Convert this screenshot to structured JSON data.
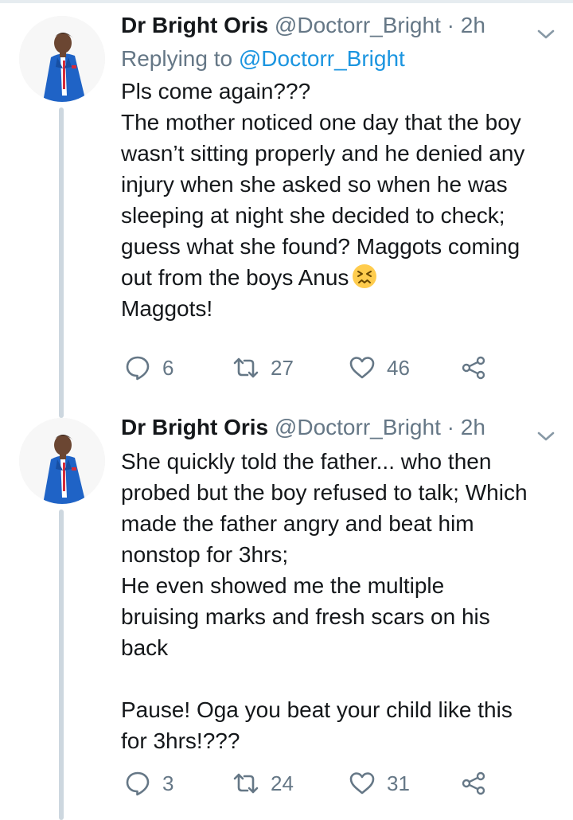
{
  "tweets": [
    {
      "display_name": "Dr Bright Oris",
      "handle": "@Doctorr_Bright",
      "separator": "·",
      "time": "2h",
      "replying_prefix": "Replying to",
      "replying_to": "@Doctorr_Bright",
      "lines": [
        "Pls come again???",
        "The mother noticed one day that the boy",
        "wasn’t sitting properly and he denied any",
        "injury when she asked so when he was",
        "sleeping at night she decided to check;",
        "guess what she found? Maggots coming",
        "out from the boys Anus",
        "Maggots!"
      ],
      "emoji": "confounded-face-emoji",
      "replies": "6",
      "retweets": "27",
      "likes": "46"
    },
    {
      "display_name": "Dr Bright Oris",
      "handle": "@Doctorr_Bright",
      "separator": "·",
      "time": "2h",
      "lines": [
        "She quickly told the father... who then",
        "probed but the boy refused to talk; Which",
        "made the father angry and beat him",
        "nonstop for 3hrs;",
        "He even showed me the multiple",
        "bruising marks and fresh scars on his",
        "back",
        "",
        "Pause! Oga you beat your child like this",
        "for 3hrs!???"
      ],
      "replies": "3",
      "retweets": "24",
      "likes": "31"
    }
  ],
  "colors": {
    "text": "#14171a",
    "secondary": "#657786",
    "link": "#1b95e0",
    "thread_line": "#cdd7df",
    "avatar_suit": "#1f63c6"
  },
  "icons": {
    "reply": "reply-icon",
    "retweet": "retweet-icon",
    "like": "heart-icon",
    "share": "share-icon",
    "more": "chevron-down-icon"
  }
}
